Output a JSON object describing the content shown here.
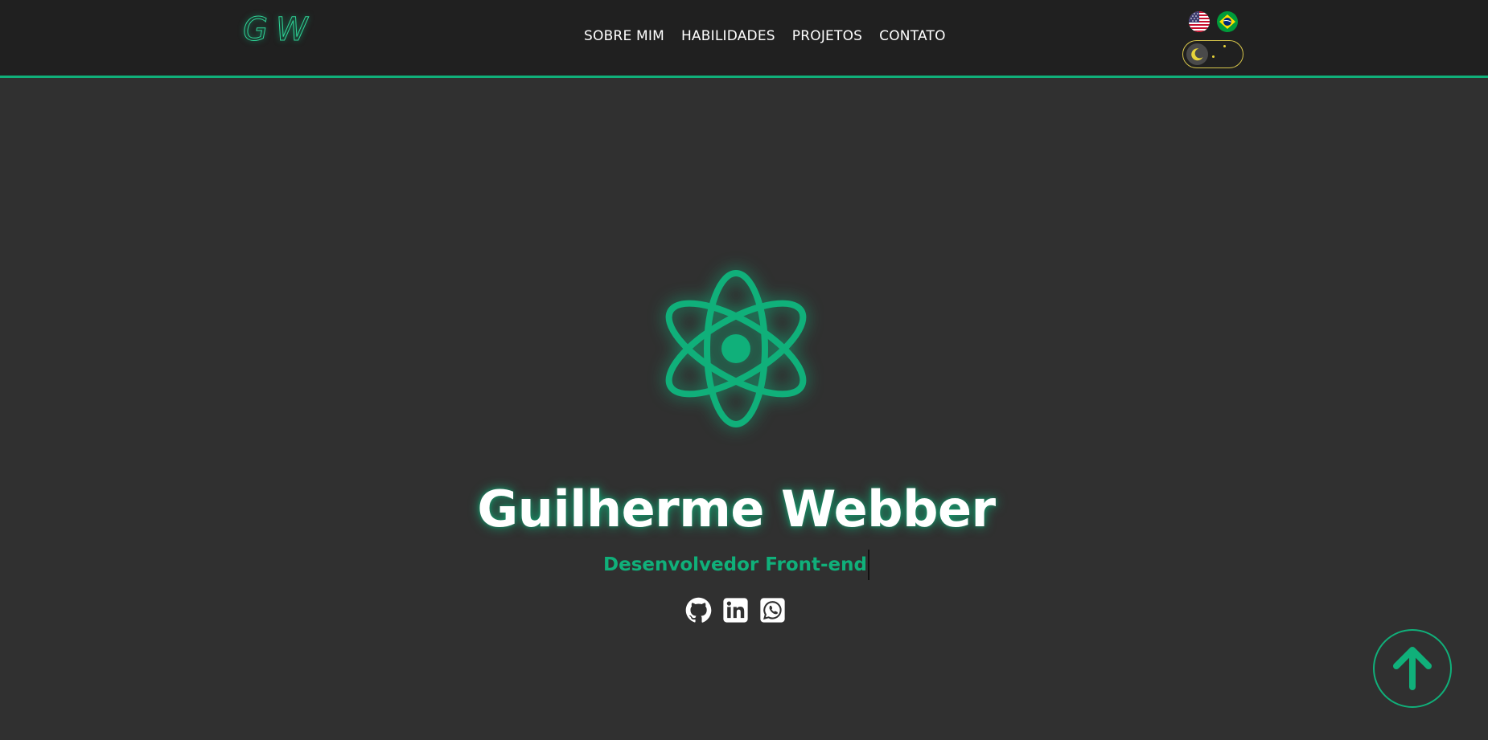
{
  "header": {
    "logo": "GW",
    "nav": [
      {
        "label": "SOBRE MIM"
      },
      {
        "label": "HABILIDADES"
      },
      {
        "label": "PROJETOS"
      },
      {
        "label": "CONTATO"
      }
    ],
    "languages": [
      {
        "icon": "us-flag-icon",
        "code": "en"
      },
      {
        "icon": "brazil-flag-icon",
        "code": "pt-BR"
      }
    ],
    "theme_toggle": {
      "state": "dark",
      "icon": "moon-icon"
    }
  },
  "hero": {
    "icon": "react-atom-icon",
    "name": "Guilherme Webber",
    "role": "Desenvolvedor Front-end",
    "socials": [
      {
        "icon": "github-icon"
      },
      {
        "icon": "linkedin-icon"
      },
      {
        "icon": "whatsapp-icon"
      }
    ]
  },
  "scroll_top": {
    "icon": "arrow-up-icon"
  },
  "colors": {
    "accent": "#10b07a",
    "background": "#303030",
    "header_bg": "#202020",
    "toggle_border": "#d7c64b"
  }
}
